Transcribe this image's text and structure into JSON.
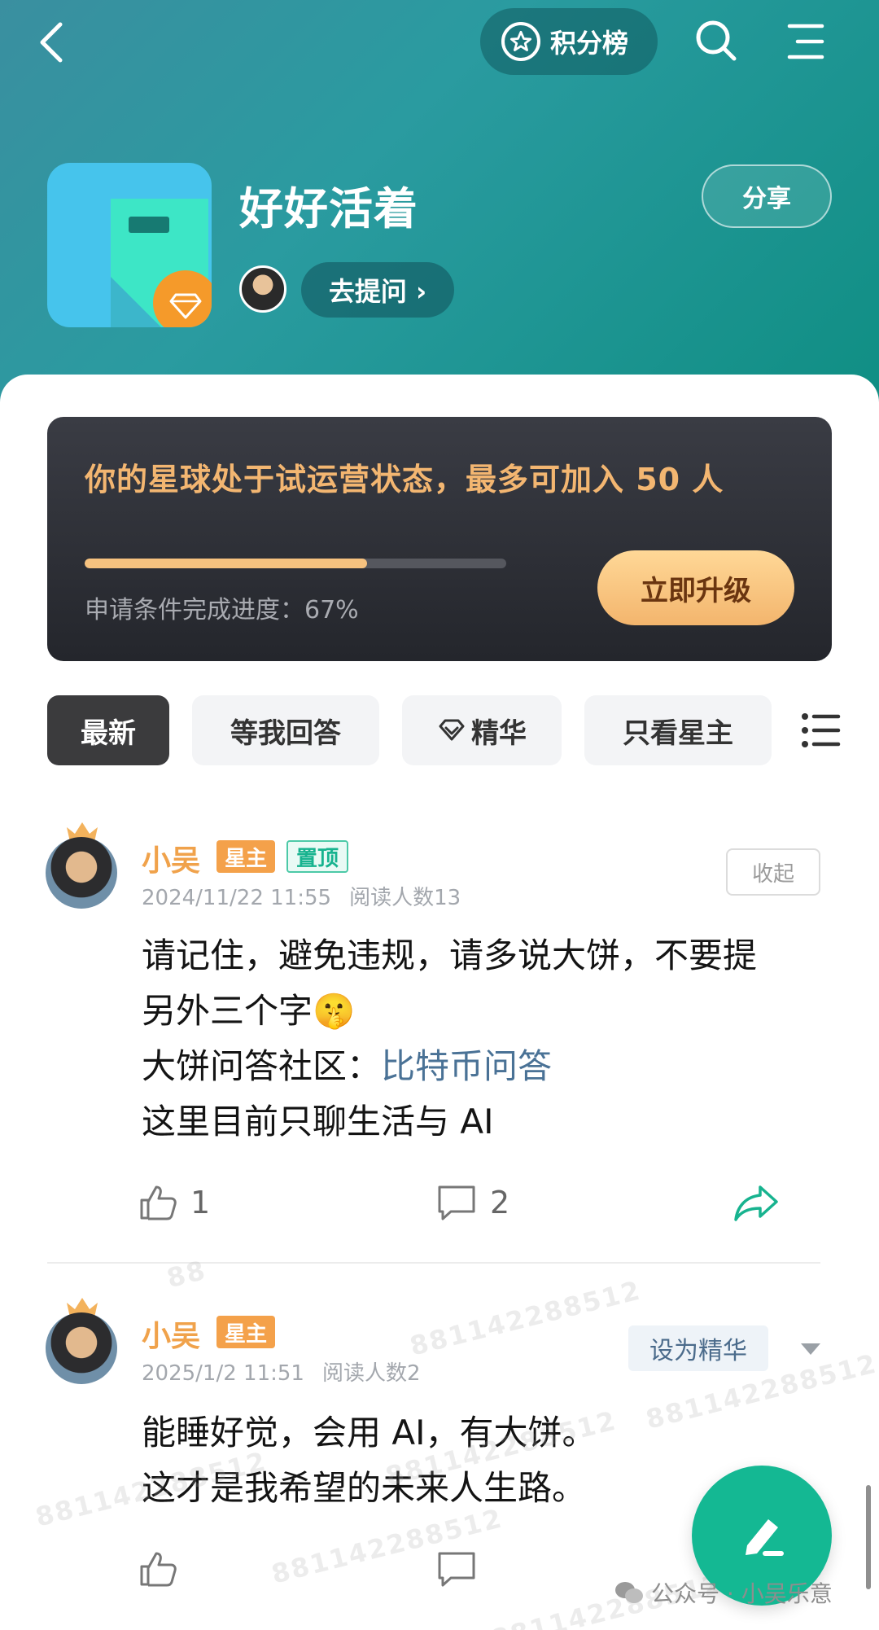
{
  "header": {
    "points_label": "积分榜",
    "group_title": "好好活着",
    "share_label": "分享",
    "ask_label": "去提问 ›"
  },
  "trial": {
    "title": "你的星球处于试运营状态，最多可加入 50 人",
    "progress_label": "申请条件完成进度：67%",
    "progress_fraction": 0.67,
    "upgrade_label": "立即升级"
  },
  "tabs": [
    {
      "label": "最新"
    },
    {
      "label": "等我回答"
    },
    {
      "label": "精华"
    },
    {
      "label": "只看星主"
    }
  ],
  "posts": [
    {
      "author": "小吴",
      "owner_badge": "星主",
      "pinned_badge": "置顶",
      "date": "2024/11/22 11:55",
      "reads": "阅读人数13",
      "collapse_label": "收起",
      "line1": "请记住，避免违规，请多说大饼，不要提",
      "line2": "另外三个字🤫",
      "line3_prefix": "大饼问答社区：",
      "line3_link": "比特币问答",
      "line4": "这里目前只聊生活与 AI",
      "likes": "1",
      "comments": "2"
    },
    {
      "author": "小吴",
      "owner_badge": "星主",
      "date": "2025/1/2 11:51",
      "reads": "阅读人数2",
      "feature_label": "设为精华",
      "line1": "能睡好觉，会用 AI，有大饼。",
      "line2": "这才是我希望的未来人生路。"
    }
  ],
  "watermarks": [
    "881142288512",
    "881142288512",
    "881142288512",
    "881142288512",
    "881142288512",
    "881142288512",
    "88"
  ],
  "footer": {
    "text": "公众号 · 小吴乐意"
  },
  "colors": {
    "accent": "#14b893",
    "owner_name": "#f0a24b",
    "trial_title": "#f3b671",
    "link": "#4a7296"
  }
}
